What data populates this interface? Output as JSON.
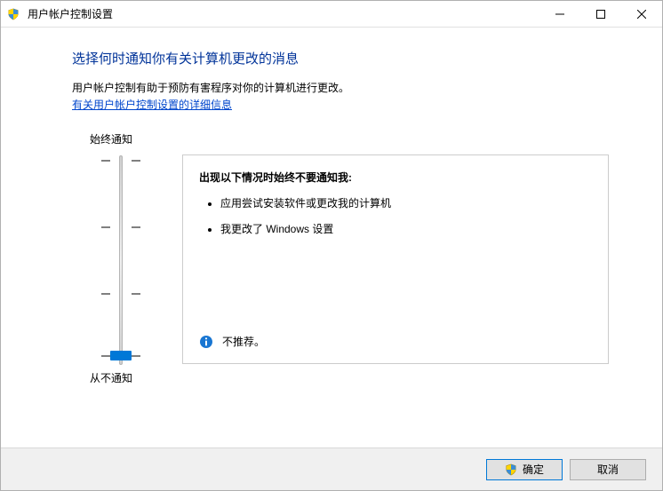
{
  "window": {
    "title": "用户帐户控制设置"
  },
  "page": {
    "heading": "选择何时通知你有关计算机更改的消息",
    "description": "用户帐户控制有助于预防有害程序对你的计算机进行更改。",
    "link": "有关用户帐户控制设置的详细信息"
  },
  "slider": {
    "top_label": "始终通知",
    "bottom_label": "从不通知",
    "level": 0,
    "levels": 4
  },
  "panel": {
    "title": "出现以下情况时始终不要通知我:",
    "bullets": [
      "应用尝试安装软件或更改我的计算机",
      "我更改了 Windows 设置"
    ],
    "recommendation": "不推荐。"
  },
  "footer": {
    "ok": "确定",
    "cancel": "取消"
  }
}
